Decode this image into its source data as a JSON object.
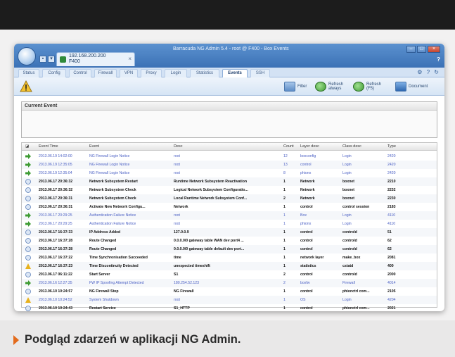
{
  "window": {
    "title": "Barracuda NG Admin 5.4 -  root @ F400  -  Box Events",
    "connection": {
      "ip": "192.168.200.200",
      "name": "F400"
    }
  },
  "ribbon_tabs": [
    {
      "label": "Status",
      "active": false
    },
    {
      "label": "Config",
      "active": false
    },
    {
      "label": "Control",
      "active": false
    },
    {
      "label": "Firewall",
      "active": false
    },
    {
      "label": "VPN",
      "active": false
    },
    {
      "label": "Proxy",
      "active": false
    },
    {
      "label": "Login",
      "active": false
    },
    {
      "label": "Statistics",
      "active": false
    },
    {
      "label": "Events",
      "active": true
    },
    {
      "label": "SSH",
      "active": false
    }
  ],
  "toolbar": {
    "filter_label": "Filter",
    "refresh_always_label": "Refresh always",
    "refresh_label": "Refresh (F5)",
    "document_label": "Document"
  },
  "current_event": {
    "title": "Current Event"
  },
  "grid": {
    "columns": [
      "Event Time",
      "Event",
      "Desc",
      "Count",
      "Layer desc",
      "Class desc",
      "Type"
    ],
    "rows": [
      {
        "icon": "green",
        "style": "blue",
        "time": "2013.06.19 14:02:00",
        "event": "NG Firewall Login Notice",
        "desc": "root",
        "count": "12",
        "layer": "boxconfig",
        "class": "Login",
        "type": "2420"
      },
      {
        "icon": "green",
        "style": "blue",
        "time": "2013.06.19 12:35:05",
        "event": "NG Firewall Login Notice",
        "desc": "root",
        "count": "13",
        "layer": "control",
        "class": "Login",
        "type": "2420"
      },
      {
        "icon": "green",
        "style": "blue",
        "time": "2013.06.19 12:35:04",
        "event": "NG Firewall Login Notice",
        "desc": "root",
        "count": "8",
        "layer": "phionx",
        "class": "Login",
        "type": "2420"
      },
      {
        "icon": "info",
        "style": "bold",
        "time": "2013.06.17 20:36:32",
        "event": "Network Subsystem Restart",
        "desc": "Runtime Network Subsystem Reactivation",
        "count": "1",
        "layer": "Network",
        "class": "boxnet",
        "type": "2210"
      },
      {
        "icon": "info",
        "style": "bold",
        "time": "2013.06.17 20:36:32",
        "event": "Network Subsystem Check",
        "desc": "Logical Network Subsystem Configuratio...",
        "count": "1",
        "layer": "Network",
        "class": "boxnet",
        "type": "2232"
      },
      {
        "icon": "info",
        "style": "bold",
        "time": "2013.06.17 20:36:31",
        "event": "Network Subsystem Check",
        "desc": "Local Runtime Network Subsystem Conf...",
        "count": "2",
        "layer": "Network",
        "class": "boxnet",
        "type": "2230"
      },
      {
        "icon": "info",
        "style": "bold",
        "time": "2013.06.17 20:36:31",
        "event": "Activate New Network Configu...",
        "desc": "Network",
        "count": "1",
        "layer": "control",
        "class": "control session",
        "type": "2183"
      },
      {
        "icon": "green",
        "style": "blue",
        "time": "2013.06.17 20:29:25",
        "event": "Authentication Failure Notice",
        "desc": "root",
        "count": "1",
        "layer": "Box",
        "class": "Login",
        "type": "4110"
      },
      {
        "icon": "green",
        "style": "blue",
        "time": "2013.06.17 20:29:25",
        "event": "Authentication Failure Notice",
        "desc": "root",
        "count": "1",
        "layer": "phionx",
        "class": "Login",
        "type": "4110"
      },
      {
        "icon": "info",
        "style": "bold",
        "time": "2013.06.17 16:37:33",
        "event": "IP Address Added",
        "desc": "127.0.0.9",
        "count": "1",
        "layer": "control",
        "class": "controld",
        "type": "51"
      },
      {
        "icon": "info",
        "style": "bold",
        "time": "2013.06.17 16:37:28",
        "event": "Route Changed",
        "desc": "0.0.0.0/0 gateway table WAN dev port4 ...",
        "count": "1",
        "layer": "control",
        "class": "controld",
        "type": "62"
      },
      {
        "icon": "info",
        "style": "bold",
        "time": "2013.06.17 16:37:28",
        "event": "Route Changed",
        "desc": "0.0.0.0/0 gateway table default dev port...",
        "count": "1",
        "layer": "control",
        "class": "controld",
        "type": "62"
      },
      {
        "icon": "info",
        "style": "bold",
        "time": "2013.06.17 16:37:22",
        "event": "Time Synchronisation Succeeded",
        "desc": "time",
        "count": "1",
        "layer": "network layer",
        "class": "make_box",
        "type": "2081"
      },
      {
        "icon": "warn",
        "style": "bold",
        "time": "2013.06.17 16:37:23",
        "event": "Time Discontinuity Detected",
        "desc": "unexpected timeshift",
        "count": "1",
        "layer": "statistics",
        "class": "cstatd",
        "type": "400"
      },
      {
        "icon": "info",
        "style": "bold",
        "time": "2013.06.17 06:11:22",
        "event": "Start Server",
        "desc": "S1",
        "count": "2",
        "layer": "control",
        "class": "controld",
        "type": "2000"
      },
      {
        "icon": "green",
        "style": "blue",
        "time": "2013.06.16 12:27:35",
        "event": "FW IP Spoofing Attempt Detected",
        "desc": "180.254.52.123",
        "count": "2",
        "layer": "boxfw",
        "class": "Firewall",
        "type": "4014"
      },
      {
        "icon": "info",
        "style": "bold",
        "time": "2013.06.10 10:24:57",
        "event": "NG Firewall Stop",
        "desc": "NG Firewall",
        "count": "1",
        "layer": "control",
        "class": "phionctrl com...",
        "type": "2105"
      },
      {
        "icon": "warn",
        "style": "blue",
        "time": "2013.06.10 10:24:52",
        "event": "System Shutdown",
        "desc": "root",
        "count": "1",
        "layer": "OS",
        "class": "Login",
        "type": "4204"
      },
      {
        "icon": "info",
        "style": "bold",
        "time": "2013.06.10 10:24:43",
        "event": "Restart Service",
        "desc": "S1_HTTP",
        "count": "1",
        "layer": "control",
        "class": "phionctrl com...",
        "type": "2021"
      }
    ]
  },
  "caption": "Podgląd zdarzeń w aplikacji NG Admin.",
  "colors": {
    "accent": "#e36b1c",
    "event_blue": "#4a5fc4",
    "titlebar": "#3c72b6"
  }
}
